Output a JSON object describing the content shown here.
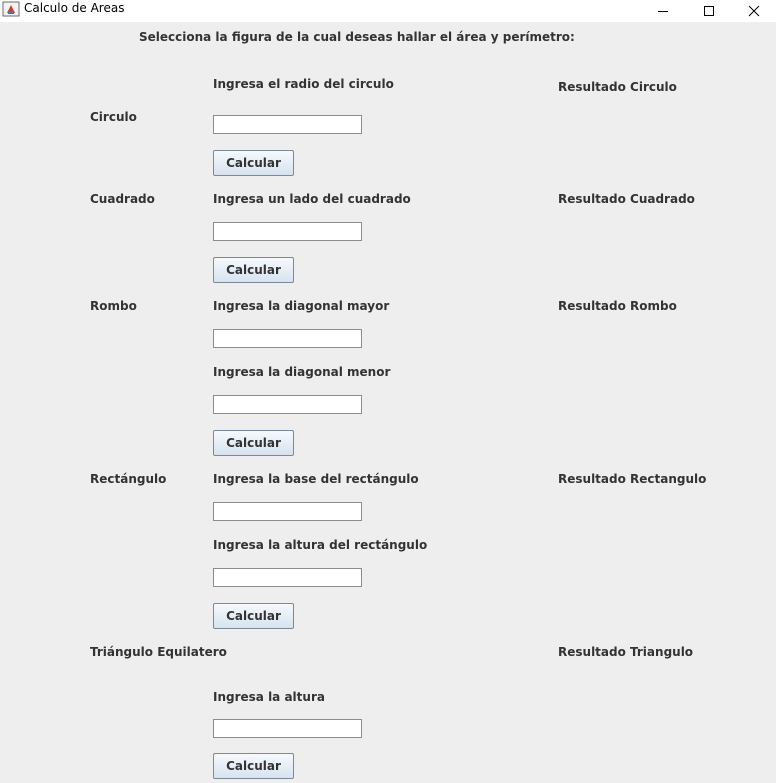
{
  "window": {
    "title": "Calculo de Areas",
    "icons": {
      "app": "java-cup-icon",
      "minimize": "minimize-icon",
      "maximize": "maximize-icon",
      "close": "close-icon"
    }
  },
  "header": {
    "instruction": "Selecciona la figura de la cual deseas hallar el área y perímetro:"
  },
  "circulo": {
    "name": "Circulo",
    "input1_label": "Ingresa el radio del circulo",
    "input1_value": "",
    "button": "Calcular",
    "result": "Resultado Circulo"
  },
  "cuadrado": {
    "name": "Cuadrado",
    "input1_label": "Ingresa un lado del cuadrado",
    "input1_value": "",
    "button": "Calcular",
    "result": "Resultado Cuadrado"
  },
  "rombo": {
    "name": "Rombo",
    "input1_label": "Ingresa la diagonal mayor",
    "input1_value": "",
    "input2_label": "Ingresa la diagonal menor",
    "input2_value": "",
    "button": "Calcular",
    "result": "Resultado Rombo"
  },
  "rectangulo": {
    "name": "Rectángulo",
    "input1_label": "Ingresa la base del rectángulo",
    "input1_value": "",
    "input2_label": "Ingresa la altura del rectángulo",
    "input2_value": "",
    "button": "Calcular",
    "result": "Resultado Rectangulo"
  },
  "triangulo": {
    "name": "Triángulo Equilatero",
    "input1_label": "Ingresa la altura",
    "input1_value": "",
    "button": "Calcular",
    "result": "Resultado Triangulo"
  }
}
